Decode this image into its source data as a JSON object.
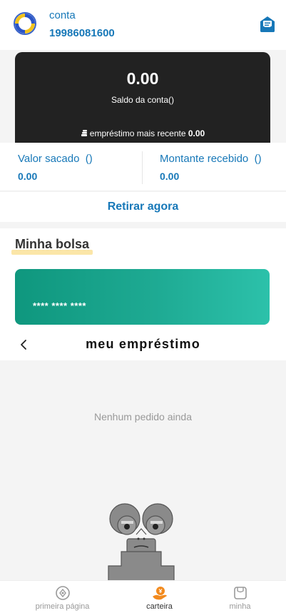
{
  "header": {
    "account_label": "conta",
    "phone": "19986081600"
  },
  "balance": {
    "amount": "0.00",
    "label": "Saldo da conta()",
    "recent_loan_label": "empréstimo mais recente",
    "recent_loan_value": "0.00"
  },
  "stats": {
    "withdrawn_label": "Valor sacado",
    "withdrawn_unit": "()",
    "withdrawn_value": "0.00",
    "received_label": "Montante recebido",
    "received_unit": "()",
    "received_value": "0.00"
  },
  "withdraw_button": "Retirar agora",
  "wallet": {
    "title": "Minha bolsa",
    "card_number": "**** **** ****"
  },
  "loans": {
    "title": "meu empréstimo",
    "empty_text": "Nenhum pedido ainda"
  },
  "tabbar": {
    "items": [
      {
        "label": "primeira página",
        "icon": "compass-icon"
      },
      {
        "label": "carteira",
        "icon": "wallet-icon",
        "active": true
      },
      {
        "label": "minha",
        "icon": "profile-icon"
      }
    ]
  },
  "colors": {
    "brand_blue": "#1778b8",
    "card_dark": "#222222",
    "card_green": "#1eaa93",
    "active_tab": "#f28a1e"
  }
}
